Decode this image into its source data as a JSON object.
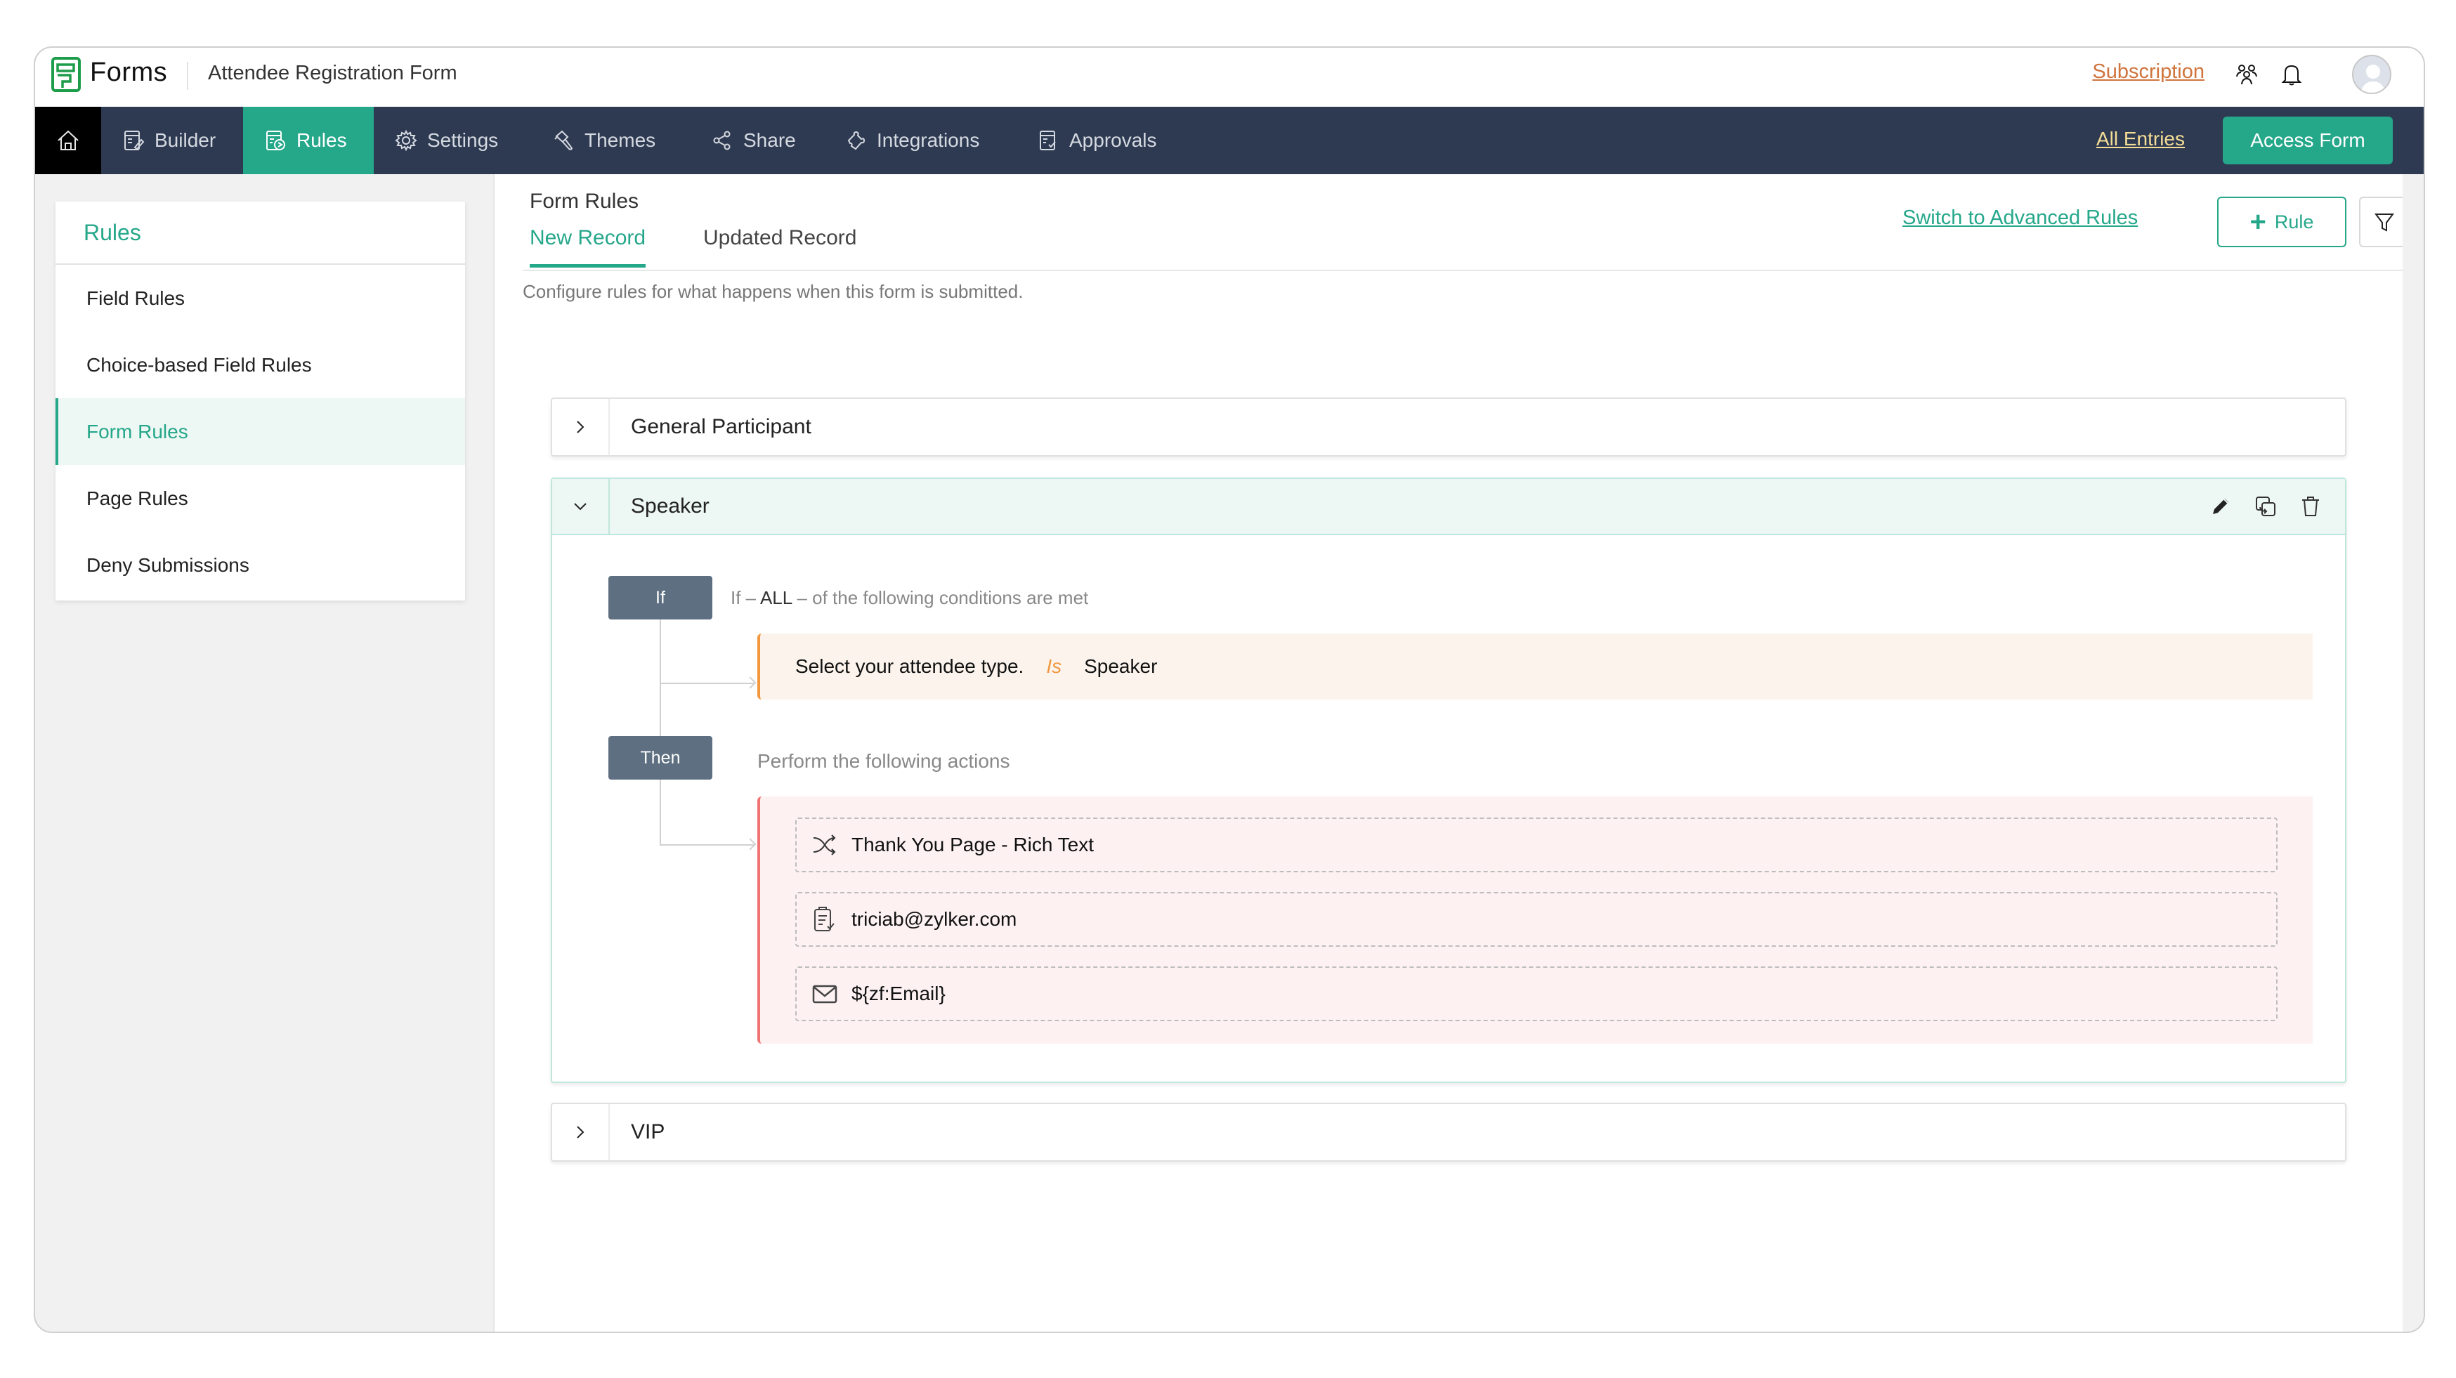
{
  "app": {
    "brand": "Forms",
    "form_name": "Attendee Registration Form",
    "subscription_label": "Subscription",
    "icons": {
      "team": "team-icon",
      "bell": "bell-icon",
      "avatar": "avatar"
    }
  },
  "nav": {
    "home_icon": "home-icon",
    "items": [
      {
        "label": "Builder",
        "icon": "builder-icon",
        "active": false
      },
      {
        "label": "Rules",
        "icon": "rules-icon",
        "active": true
      },
      {
        "label": "Settings",
        "icon": "gear-icon",
        "active": false
      },
      {
        "label": "Themes",
        "icon": "paint-brush-icon",
        "active": false
      },
      {
        "label": "Share",
        "icon": "share-icon",
        "active": false
      },
      {
        "label": "Integrations",
        "icon": "puzzle-icon",
        "active": false
      },
      {
        "label": "Approvals",
        "icon": "approvals-icon",
        "active": false
      }
    ],
    "all_entries_label": "All Entries",
    "access_form_label": "Access Form"
  },
  "sidebar": {
    "title": "Rules",
    "items": [
      {
        "label": "Field Rules",
        "active": false
      },
      {
        "label": "Choice-based Field Rules",
        "active": false
      },
      {
        "label": "Form Rules",
        "active": true
      },
      {
        "label": "Page Rules",
        "active": false
      },
      {
        "label": "Deny Submissions",
        "active": false
      }
    ]
  },
  "main": {
    "title": "Form Rules",
    "tabs": [
      {
        "label": "New Record",
        "active": true
      },
      {
        "label": "Updated Record",
        "active": false
      }
    ],
    "description": "Configure rules for what happens when this form is submitted.",
    "advanced_link": "Switch to Advanced Rules",
    "add_rule_label": "Rule",
    "filter_icon": "filter-icon",
    "rules": [
      {
        "name": "General Participant",
        "expanded": false
      },
      {
        "name": "Speaker",
        "expanded": true,
        "if_badge": "If",
        "condition_prefix": "If –",
        "condition_match": "ALL",
        "condition_suffix": "–  of the following conditions are met",
        "conditions": [
          {
            "field": "Select your attendee type.",
            "operator": "Is",
            "value": "Speaker"
          }
        ],
        "then_badge": "Then",
        "actions_heading": "Perform the following actions",
        "actions": [
          {
            "icon": "redirect-shuffle-icon",
            "text": "Thank You Page - Rich Text"
          },
          {
            "icon": "clipboard-check-icon",
            "text": "triciab@zylker.com"
          },
          {
            "icon": "mail-icon",
            "text": "${zf:Email}"
          }
        ]
      },
      {
        "name": "VIP",
        "expanded": false
      }
    ]
  },
  "colors": {
    "accent": "#25a78a",
    "nav_bg": "#2e3a52",
    "subscription": "#d0743c",
    "all_entries": "#f5dd96",
    "condition_accent": "#f3973f",
    "action_accent": "#f07474"
  }
}
